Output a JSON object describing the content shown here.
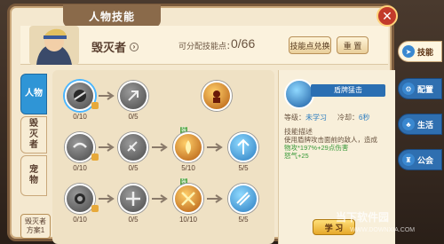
{
  "window": {
    "title": "人物技能",
    "close_icon": "close-icon"
  },
  "header": {
    "character_name": "毁灭者",
    "points_label": "可分配技能点：",
    "points_value": "0/66",
    "exchange_button": "技能点兑换",
    "reset_button": "重 置"
  },
  "left_tabs": [
    {
      "label": "人物",
      "active": true
    },
    {
      "label": "毁灭者",
      "active": false
    },
    {
      "label": "宠物",
      "active": false
    }
  ],
  "plan_button": "毁灭者\n方案1",
  "skill_tree": {
    "rows": [
      [
        {
          "count": "0/10",
          "style": "grey",
          "selected": true
        },
        {
          "count": "0/5",
          "style": "grey"
        },
        {
          "count": "",
          "style": "fire"
        }
      ],
      [
        {
          "count": "0/10",
          "style": "grey"
        },
        {
          "count": "0/5",
          "style": "grey"
        },
        {
          "count": "5/10",
          "style": "fire"
        },
        {
          "count": "5/5",
          "style": "blue"
        }
      ],
      [
        {
          "count": "0/10",
          "style": "grey"
        },
        {
          "count": "0/5",
          "style": "grey"
        },
        {
          "count": "10/10",
          "style": "fire"
        },
        {
          "count": "5/5",
          "style": "blue"
        }
      ]
    ]
  },
  "detail": {
    "skill_name": "盾牌猛击",
    "level_label": "等级：",
    "level_value": "未学习",
    "cooldown_label": "冷却：",
    "cooldown_value": "6秒",
    "desc_title": "技能描述",
    "desc_line1": "使用盾牌攻击面前的敌人，造成",
    "desc_line2": "物攻*197%+29点伤害",
    "desc_line3": "怒气+25",
    "learn_button": "学 习"
  },
  "right_tabs": [
    {
      "label": "技能",
      "icon": "skill-icon",
      "active": true
    },
    {
      "label": "配置",
      "icon": "gear-icon",
      "active": false
    },
    {
      "label": "生活",
      "icon": "life-icon",
      "active": false
    },
    {
      "label": "公会",
      "icon": "guild-icon",
      "active": false
    }
  ],
  "watermark": {
    "text": "当下软件园",
    "sub": "WWW.DOWNXIA.COM"
  },
  "colors": {
    "accent_blue": "#2f95d6",
    "frame_brown": "#7a5a3c",
    "parchment": "#f4e8cf"
  }
}
